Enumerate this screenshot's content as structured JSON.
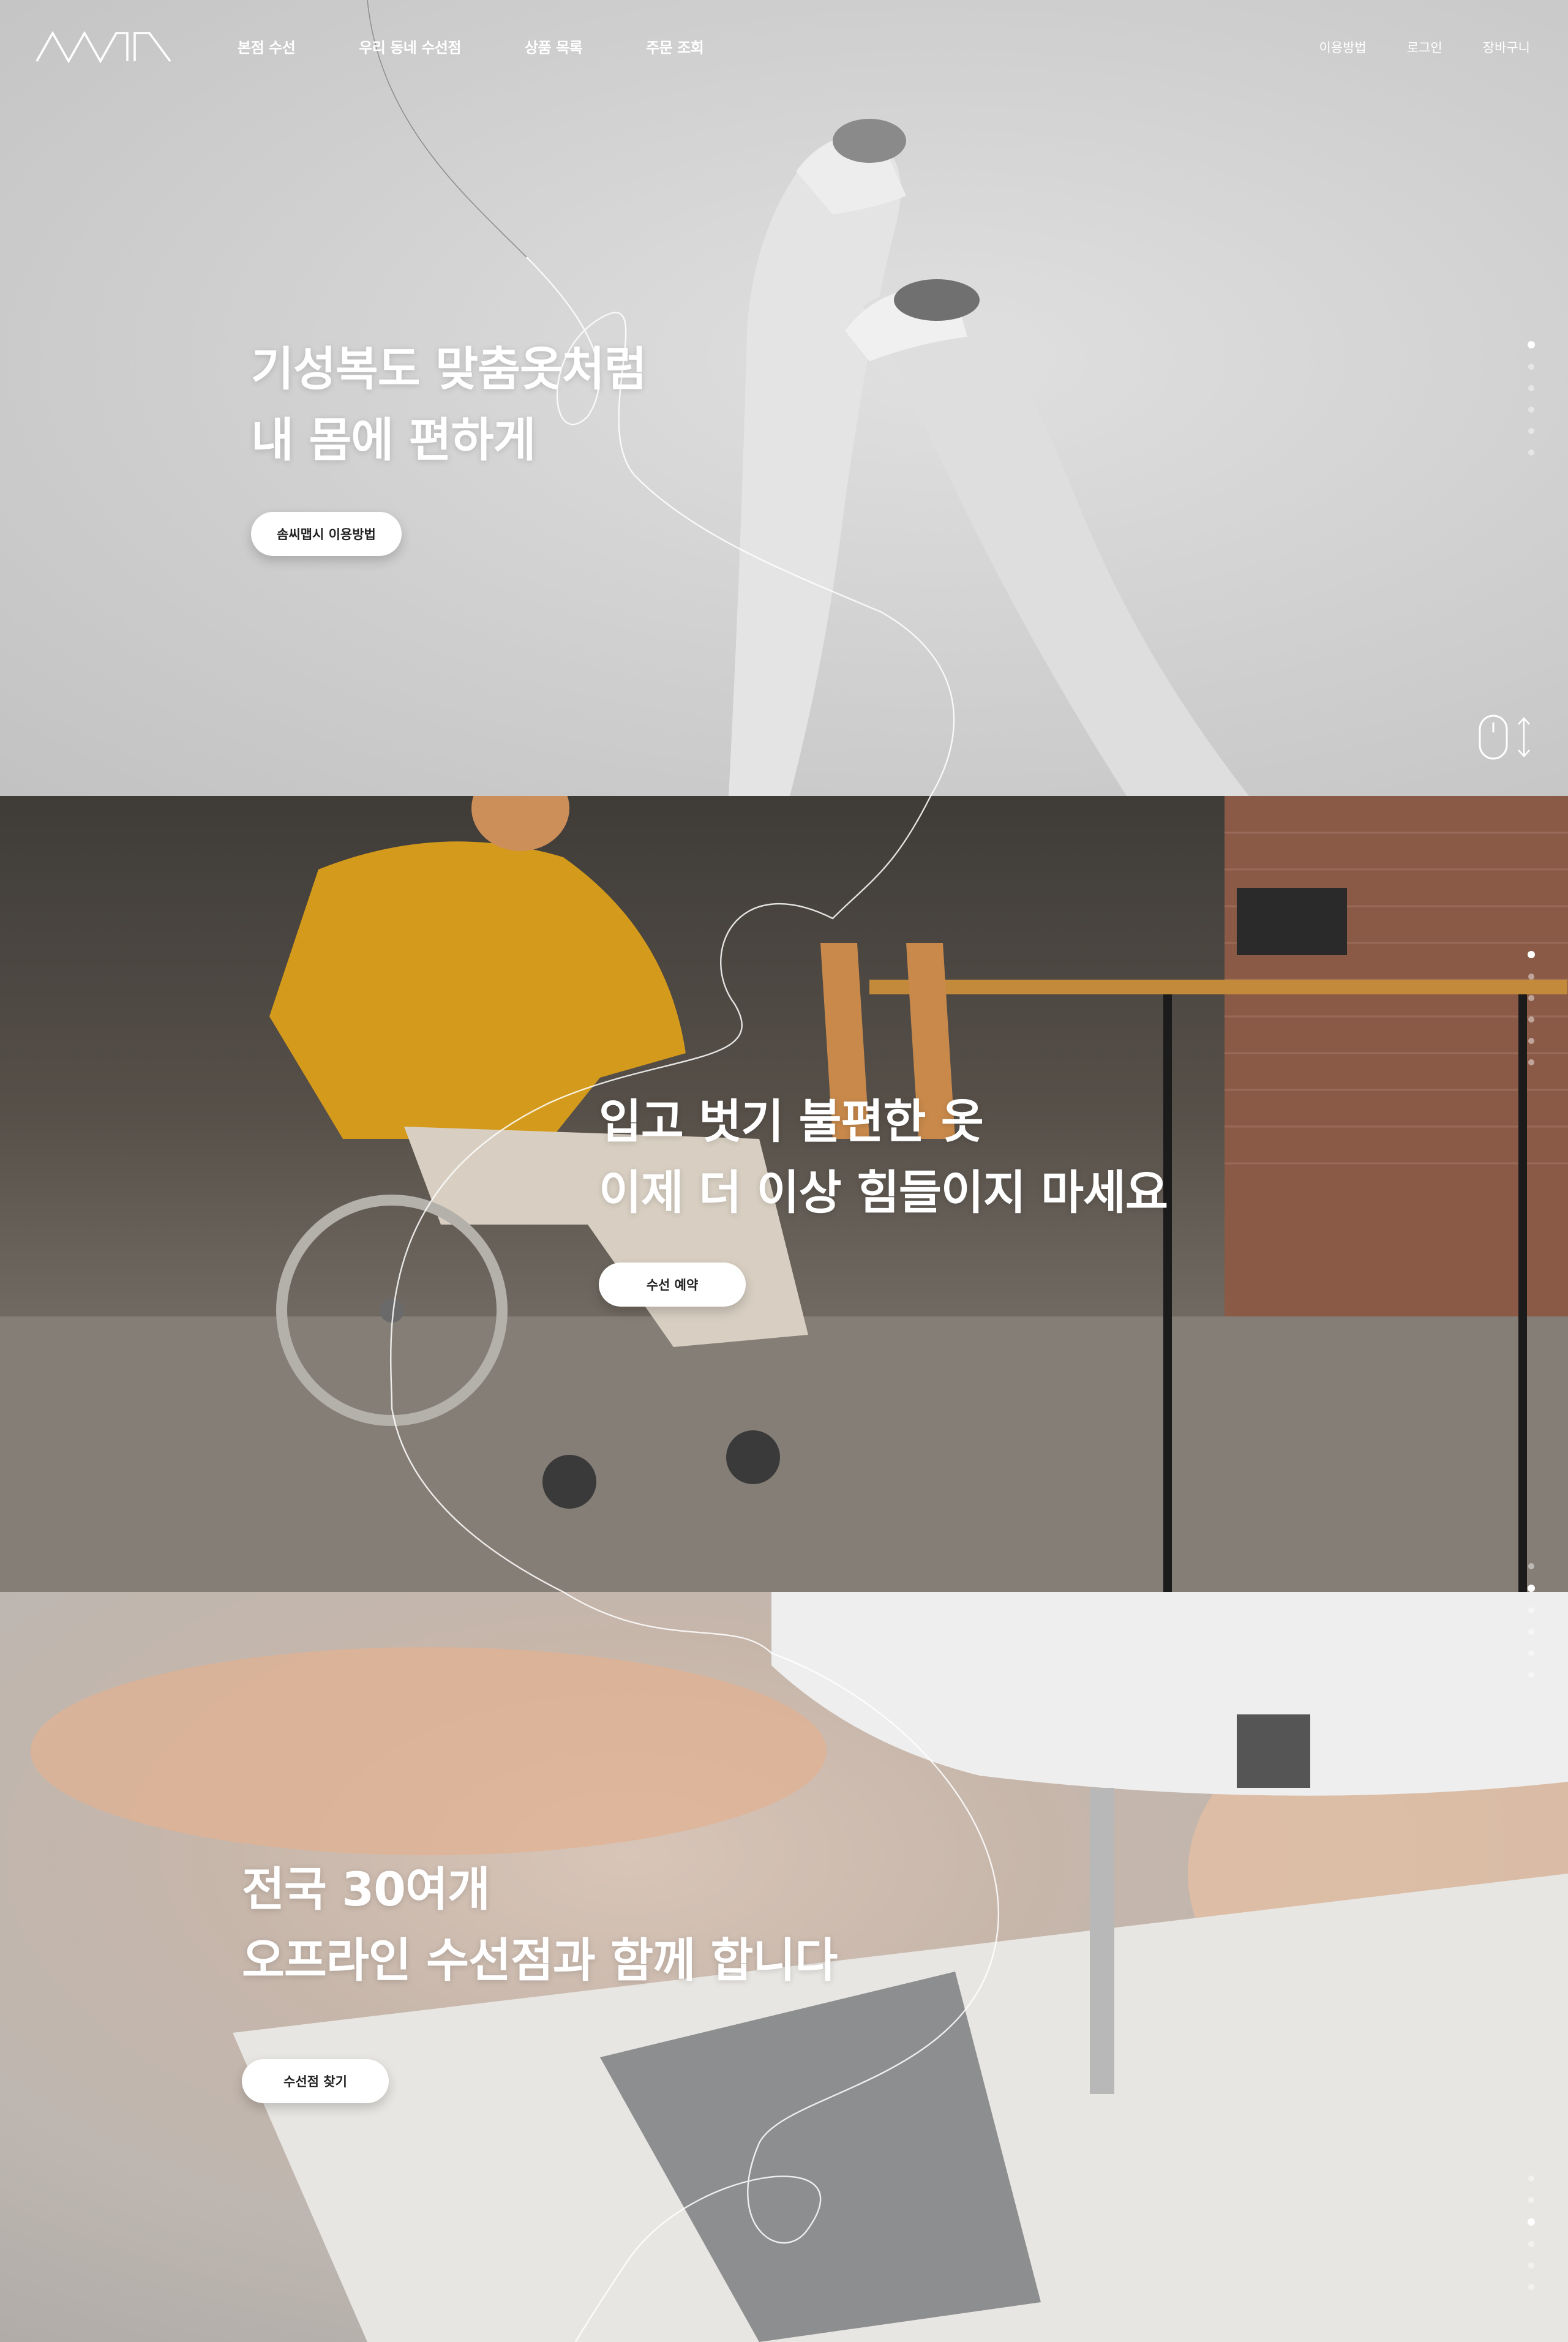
{
  "header": {
    "logo_alt": "ANNTA",
    "nav": [
      {
        "label": "본점 수선"
      },
      {
        "label": "우리 동네 수선점"
      },
      {
        "label": "상품 목록"
      },
      {
        "label": "주문 조회"
      }
    ],
    "util": [
      {
        "label": "이용방법"
      },
      {
        "label": "로그인"
      },
      {
        "label": "장바구니"
      }
    ]
  },
  "sections": [
    {
      "title_line1": "기성복도 맞춤옷처럼",
      "title_line2": "내 몸에 편하게",
      "button": "솜씨맵시 이용방법",
      "dots_total": 6,
      "dots_active": 1
    },
    {
      "title_line1": "입고 벗기 불편한 옷",
      "title_line2": "이제 더 이상 힘들이지 마세요",
      "button": "수선 예약",
      "dots_total": 6,
      "dots_active": 1
    },
    {
      "title_line1": "전국 30여개",
      "title_line2": "오프라인 수선점과 함께 합니다",
      "button": "수선점 찾기",
      "dots_total": 6,
      "dots_active": 3
    }
  ],
  "icons": {
    "scroll": "mouse-scroll-icon",
    "arrows": "up-down-arrow-icon"
  },
  "colors": {
    "hero1_bg": "#cfcfcf",
    "hero2_bg": "#4f4a44",
    "hero3_bg": "#c7b6aa",
    "button_bg": "#ffffff",
    "text_white": "#ffffff"
  }
}
